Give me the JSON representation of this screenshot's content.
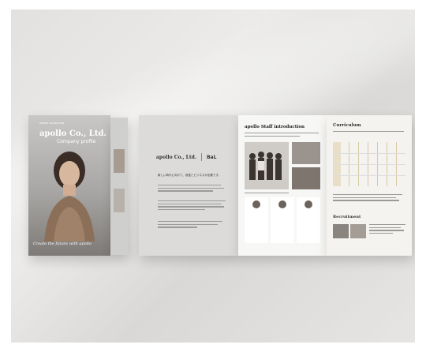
{
  "scene": {
    "description_tags": [
      "brochure-mockup",
      "tri-fold"
    ]
  },
  "cover": {
    "kicker": "RENEW COLLECTION",
    "title": "apollo Co., Ltd.",
    "subtitle": "Company profile",
    "tagline": "Create the future with apollo"
  },
  "brand": {
    "name": "apollo Co., Ltd.",
    "partner": "BaL",
    "heading": "新しい時代に向けて、前進とビジネスが必要です。"
  },
  "staff": {
    "title": "apollo Staff introduction"
  },
  "curriculum": {
    "title": "Curriculum",
    "recruitment_title": "Recruitment"
  }
}
